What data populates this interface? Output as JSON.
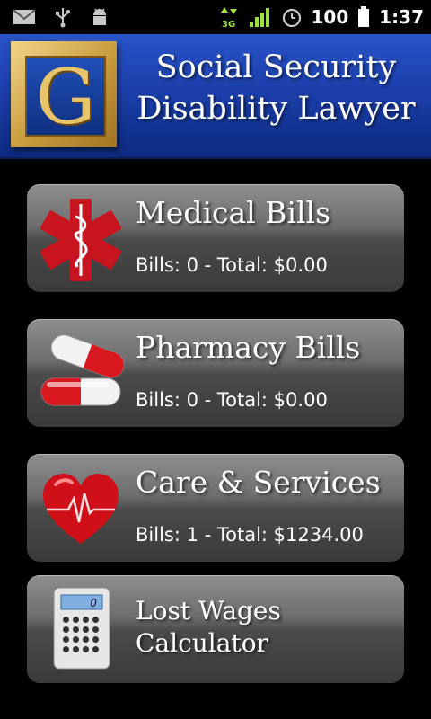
{
  "status_bar": {
    "battery": "100",
    "time": "1:37",
    "network": "3G",
    "icons": [
      "mail-icon",
      "usb-icon",
      "android-debug-icon",
      "data-transfer-icon",
      "signal-icon",
      "alarm-icon"
    ]
  },
  "banner": {
    "logo_letter": "G",
    "title_line1": "Social Security",
    "title_line2": "Disability Lawyer"
  },
  "menu": [
    {
      "title": "Medical Bills",
      "summary": "Bills: 0 - Total: $0.00",
      "icon": "medical-star-of-life-icon"
    },
    {
      "title": "Pharmacy Bills",
      "summary": "Bills: 0 - Total: $0.00",
      "icon": "pill-capsule-icon"
    },
    {
      "title": "Care & Services",
      "summary": "Bills: 1 - Total: $1234.00",
      "icon": "heart-pulse-icon"
    },
    {
      "title_line1": "Lost Wages",
      "title_line2": "Calculator",
      "icon": "calculator-icon",
      "display_value": "0"
    }
  ],
  "colors": {
    "banner_blue": "#1a3da8",
    "logo_gold": "#c79a3c",
    "button_gray": "#5a5a5a",
    "icon_red": "#c8141e"
  }
}
